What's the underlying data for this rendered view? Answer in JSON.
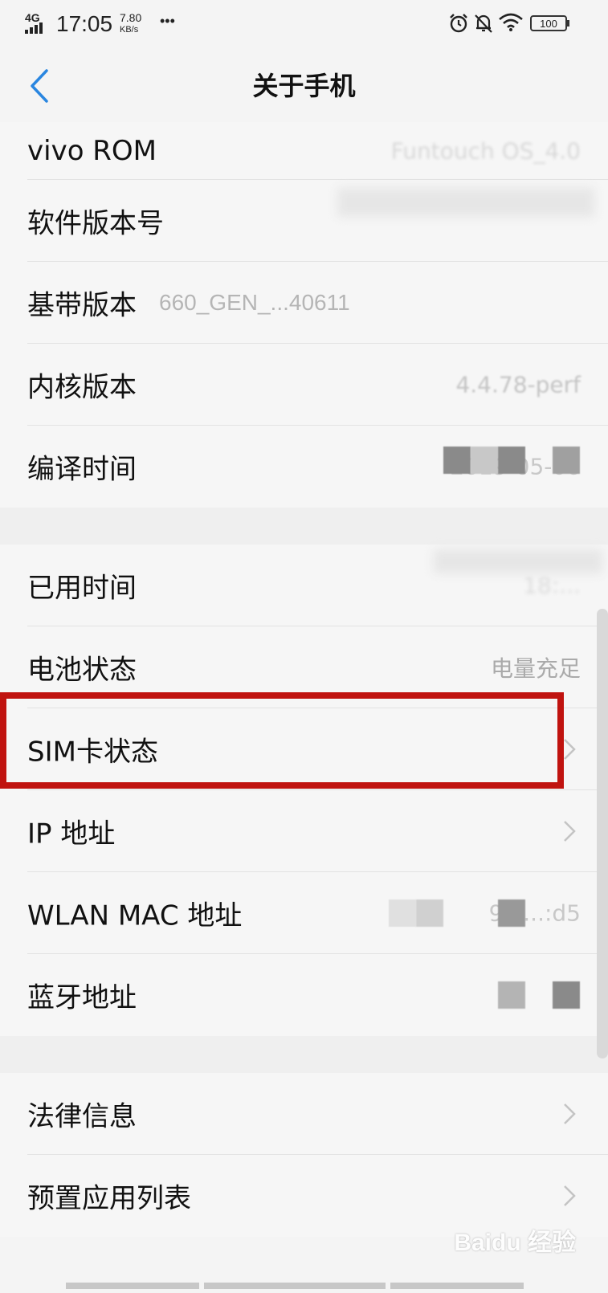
{
  "status_bar": {
    "network": "4G",
    "time": "17:05",
    "speed_value": "7.80",
    "speed_unit": "KB/s",
    "dots": "•••",
    "battery": "100"
  },
  "header": {
    "title": "关于手机"
  },
  "rows": [
    {
      "label": "vivo ROM",
      "value": "Funtouch OS_4.0"
    },
    {
      "label": "软件版本号",
      "value": ""
    },
    {
      "label": "基带版本",
      "value": "660_GEN_...40611"
    },
    {
      "label": "内核版本",
      "value": "4.4.78-perf"
    },
    {
      "label": "编译时间",
      "value": "2019-05-06"
    },
    {
      "label": "已用时间",
      "value": "18:..."
    },
    {
      "label": "电池状态",
      "value": "电量充足"
    },
    {
      "label": "SIM卡状态",
      "value": ""
    },
    {
      "label": "IP 地址",
      "value": ""
    },
    {
      "label": "WLAN MAC 地址",
      "value": "9c:...:d5"
    },
    {
      "label": "蓝牙地址",
      "value": ""
    },
    {
      "label": "法律信息",
      "value": ""
    },
    {
      "label": "预置应用列表",
      "value": ""
    }
  ],
  "watermark": "Baidu 经验",
  "colors": {
    "highlight": "#c0130f",
    "accent": "#2a86e0"
  }
}
